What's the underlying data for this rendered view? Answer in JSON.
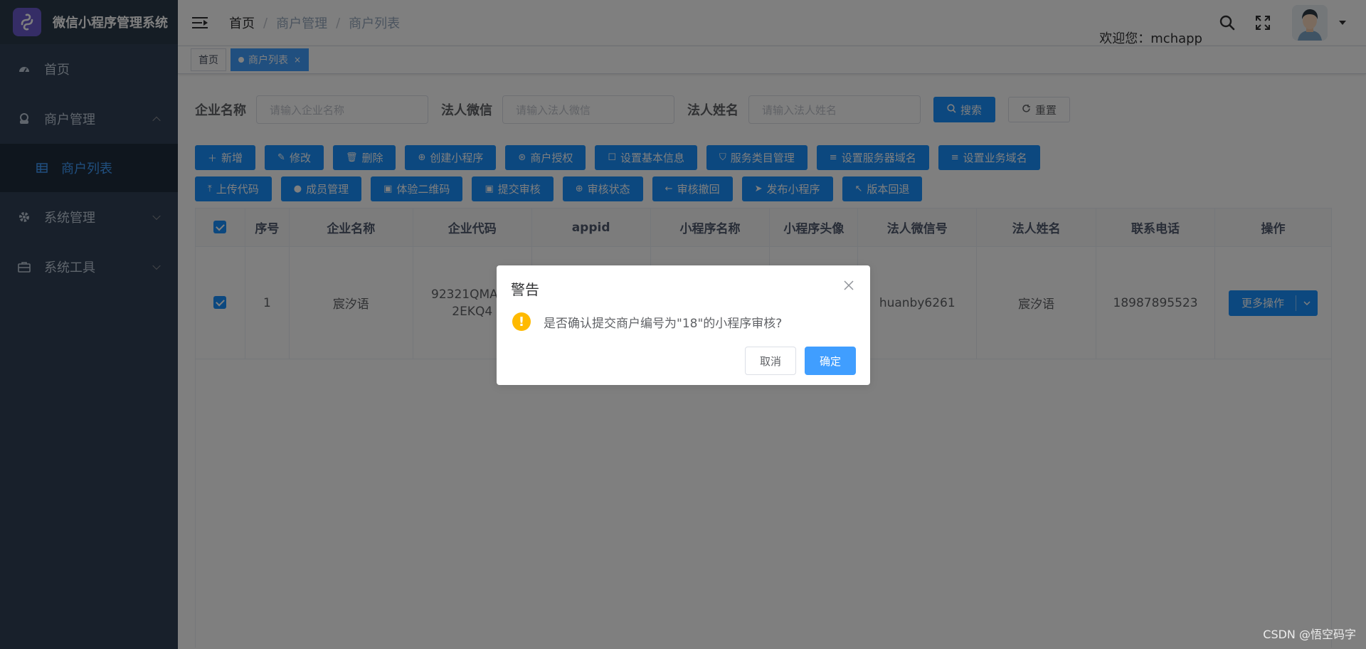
{
  "app": {
    "title": "微信小程序管理系统"
  },
  "sidebar": {
    "items": [
      {
        "label": "首页",
        "icon": "dashboard-icon"
      },
      {
        "label": "商户管理",
        "icon": "merchant-icon",
        "expanded": true
      },
      {
        "label": "系统管理",
        "icon": "gear-icon"
      },
      {
        "label": "系统工具",
        "icon": "toolbox-icon"
      }
    ],
    "submenu": {
      "label": "商户列表",
      "icon": "grid-icon"
    }
  },
  "navbar": {
    "breadcrumb": [
      "首页",
      "商户管理",
      "商户列表"
    ],
    "welcome": "欢迎您：mchapp"
  },
  "tags": [
    {
      "label": "首页"
    },
    {
      "label": "商户列表",
      "close": "×"
    }
  ],
  "search": {
    "fields": [
      {
        "label": "企业名称",
        "placeholder": "请输入企业名称"
      },
      {
        "label": "法人微信",
        "placeholder": "请输入法人微信"
      },
      {
        "label": "法人姓名",
        "placeholder": "请输入法人姓名"
      }
    ],
    "search_label": "搜索",
    "reset_label": "重置"
  },
  "toolbar": {
    "row1": [
      "新增",
      "修改",
      "删除",
      "创建小程序",
      "商户授权",
      "设置基本信息",
      "服务类目管理",
      "设置服务器域名",
      "设置业务域名"
    ],
    "row2": [
      "上传代码",
      "成员管理",
      "体验二维码",
      "提交审核",
      "审核状态",
      "审核撤回",
      "发布小程序",
      "版本回退"
    ]
  },
  "table": {
    "headers": [
      "序号",
      "企业名称",
      "企业代码",
      "appid",
      "小程序名称",
      "小程序头像",
      "法人微信号",
      "法人姓名",
      "联系电话",
      "操作"
    ],
    "rows": [
      {
        "index": "1",
        "company": "宸汐语",
        "code_line1": "92321QMA34",
        "code_line2": "2EKQ4",
        "appid": "",
        "app_name": "",
        "avatar": "",
        "wechat": "huanby6261",
        "legal_name": "宸汐语",
        "phone": "18987895523",
        "action": "更多操作"
      }
    ]
  },
  "dialog": {
    "title": "警告",
    "icon": "!",
    "message": "是否确认提交商户编号为\"18\"的小程序审核?",
    "cancel": "取消",
    "confirm": "确定"
  },
  "watermark": "CSDN @悟空码字",
  "colors": {
    "primary": "#1890ff",
    "sidebar": "#304156",
    "warning": "#ffba00"
  }
}
